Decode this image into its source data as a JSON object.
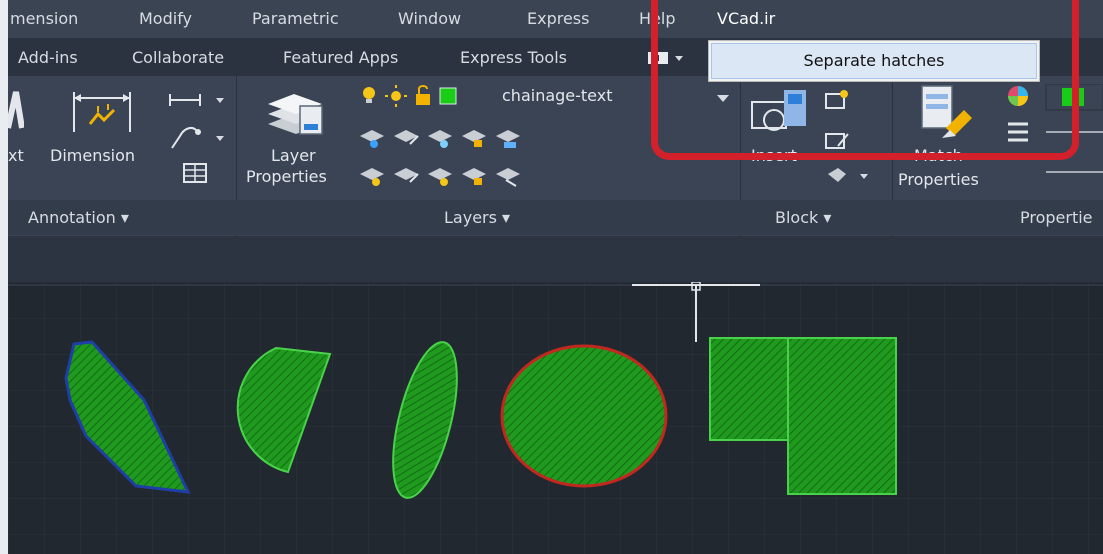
{
  "menubar": {
    "items": [
      "mension",
      "Modify",
      "Parametric",
      "Window",
      "Express",
      "Help",
      "VCad.ir"
    ]
  },
  "tabs": {
    "items": [
      "Add-ins",
      "Collaborate",
      "Featured Apps",
      "Express Tools"
    ]
  },
  "dropdown": {
    "item_label": "Separate hatches"
  },
  "ribbon": {
    "text_partial": "xt",
    "dimension_label": "Dimension",
    "layer_properties_line1": "Layer",
    "layer_properties_line2": "Properties",
    "current_layer": "chainage-text",
    "insert_label": "Insert",
    "match_line1": "Match",
    "match_line2": "Properties",
    "panels": {
      "annotation": "Annotation ▾",
      "layers": "Layers ▾",
      "block": "Block ▾",
      "properties": "Propertie"
    }
  },
  "colors": {
    "hatch_fill": "#1f9a1f",
    "hatch_outline": "#49d249",
    "boundary_blue": "#1f3fa7",
    "boundary_red": "#c3281f",
    "highlight_red": "#d3202b",
    "layer_swatch": "#18cc18"
  },
  "canvas": {
    "shapes": [
      "polygon",
      "cut-circle",
      "ellipse",
      "circle",
      "l-shape"
    ]
  },
  "icons": [
    "dimension-icon",
    "layer-properties-icon",
    "layer-state-icons",
    "insert-block-icon",
    "match-properties-icon",
    "color-wheel-icon",
    "lineweight-icon",
    "linetype-icon",
    "crosshair-cursor-icon"
  ]
}
